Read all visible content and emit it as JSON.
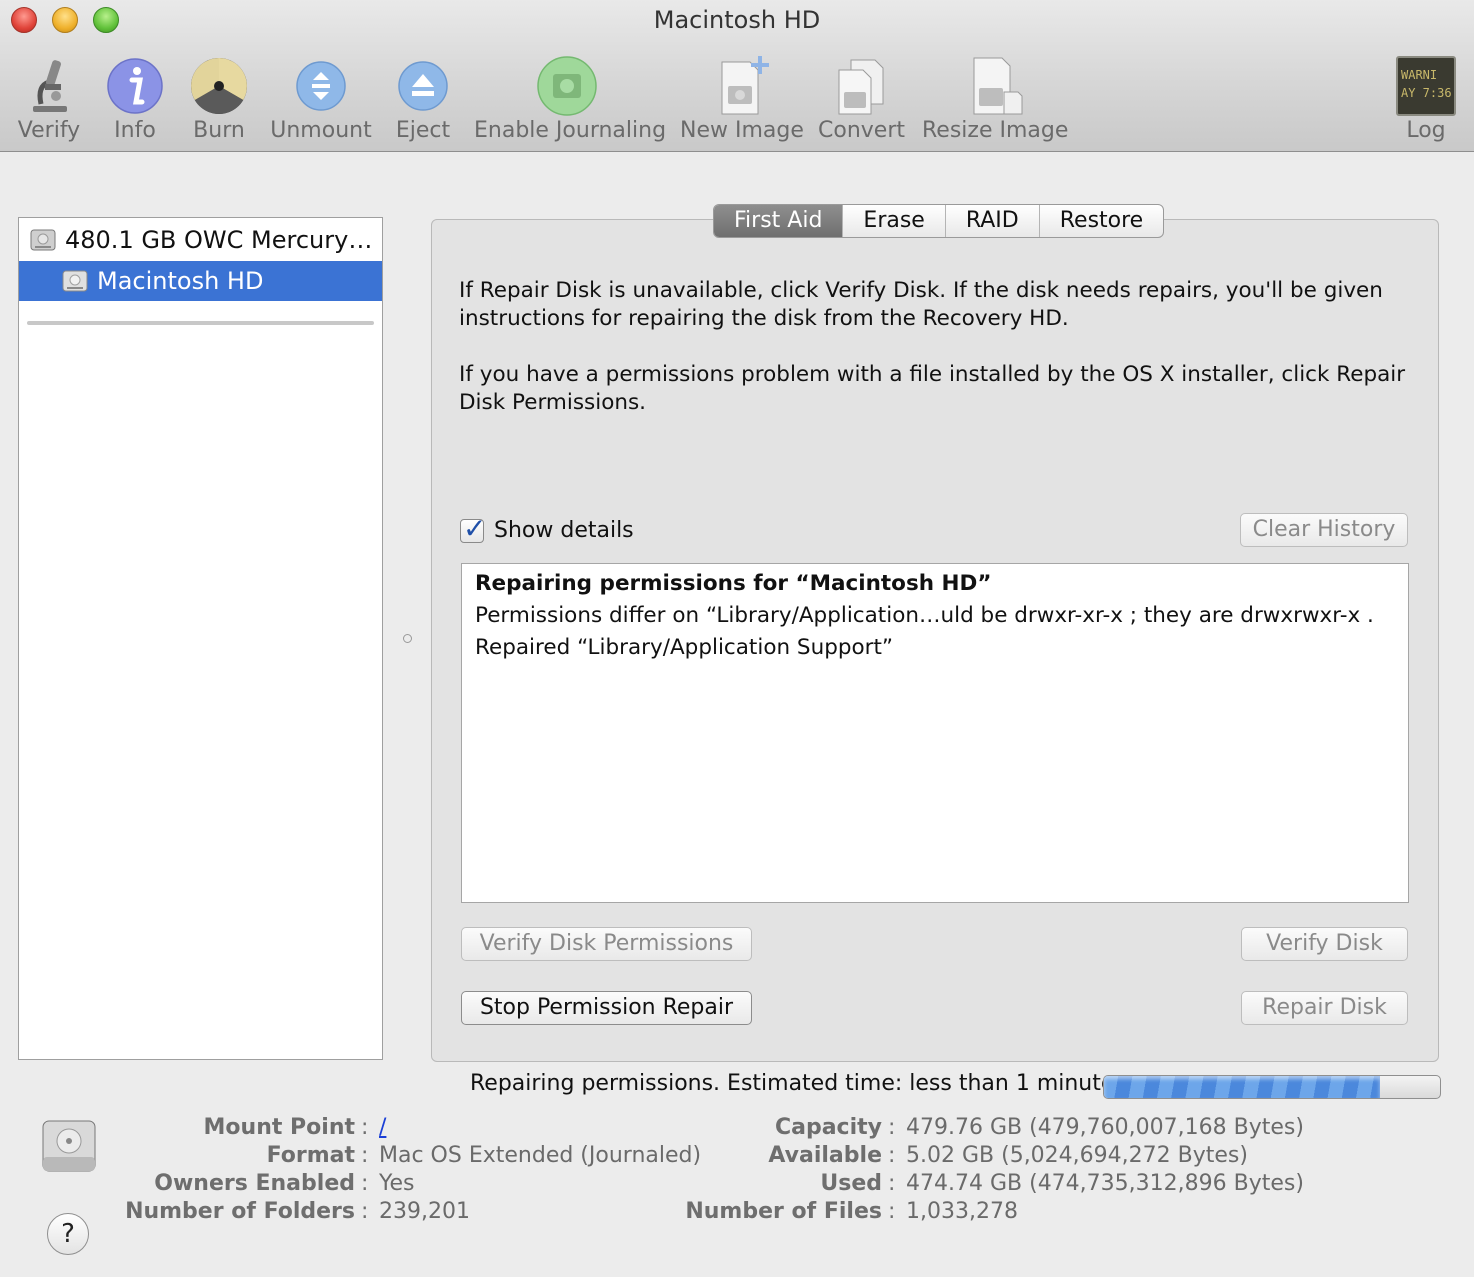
{
  "window": {
    "title": "Macintosh HD"
  },
  "toolbar": {
    "items": [
      {
        "label": "Verify",
        "icon": "microscope-icon"
      },
      {
        "label": "Info",
        "icon": "info-icon"
      },
      {
        "label": "Burn",
        "icon": "burn-icon"
      },
      {
        "label": "Unmount",
        "icon": "unmount-icon"
      },
      {
        "label": "Eject",
        "icon": "eject-icon"
      },
      {
        "label": "Enable Journaling",
        "icon": "journaling-icon"
      },
      {
        "label": "New Image",
        "icon": "new-image-icon"
      },
      {
        "label": "Convert",
        "icon": "convert-icon"
      },
      {
        "label": "Resize Image",
        "icon": "resize-image-icon"
      },
      {
        "label": "Log",
        "icon": "log-icon",
        "icon_text": "WARNI",
        "icon_text2": "AY 7:36"
      }
    ]
  },
  "sidebar": {
    "items": [
      {
        "label": "480.1 GB OWC Mercury…",
        "selected": false
      },
      {
        "label": "Macintosh HD",
        "selected": true
      }
    ]
  },
  "tabs": [
    {
      "label": "First Aid",
      "active": true
    },
    {
      "label": "Erase",
      "active": false
    },
    {
      "label": "RAID",
      "active": false
    },
    {
      "label": "Restore",
      "active": false
    }
  ],
  "first_aid": {
    "para1": "If Repair Disk is unavailable, click Verify Disk. If the disk needs repairs, you'll be given instructions for repairing the disk from the Recovery HD.",
    "para2": "If you have a permissions problem with a file installed by the OS X installer, click Repair Disk Permissions.",
    "show_details_label": "Show details",
    "show_details_checked": true,
    "clear_history_label": "Clear History",
    "log": {
      "title": "Repairing permissions for “Macintosh HD”",
      "lines": [
        "Permissions differ on “Library/Application…uld be drwxr-xr-x ; they are drwxrwxr-x .",
        "Repaired “Library/Application Support”"
      ]
    },
    "buttons": {
      "verify_permissions": "Verify Disk Permissions",
      "stop_repair": "Stop Permission Repair",
      "verify_disk": "Verify Disk",
      "repair_disk": "Repair Disk"
    },
    "status_text": "Repairing permissions. Estimated time: less than 1 minute",
    "progress": 0.82
  },
  "info": {
    "left": [
      {
        "key": "Mount Point",
        "value": "/",
        "link": true
      },
      {
        "key": "Format",
        "value": "Mac OS Extended (Journaled)"
      },
      {
        "key": "Owners Enabled",
        "value": "Yes"
      },
      {
        "key": "Number of Folders",
        "value": "239,201"
      }
    ],
    "right": [
      {
        "key": "Capacity",
        "value": "479.76 GB (479,760,007,168 Bytes)"
      },
      {
        "key": "Available",
        "value": "5.02 GB (5,024,694,272 Bytes)"
      },
      {
        "key": "Used",
        "value": "474.74 GB (474,735,312,896 Bytes)"
      },
      {
        "key": "Number of Files",
        "value": "1,033,278"
      }
    ],
    "help_label": "?"
  }
}
